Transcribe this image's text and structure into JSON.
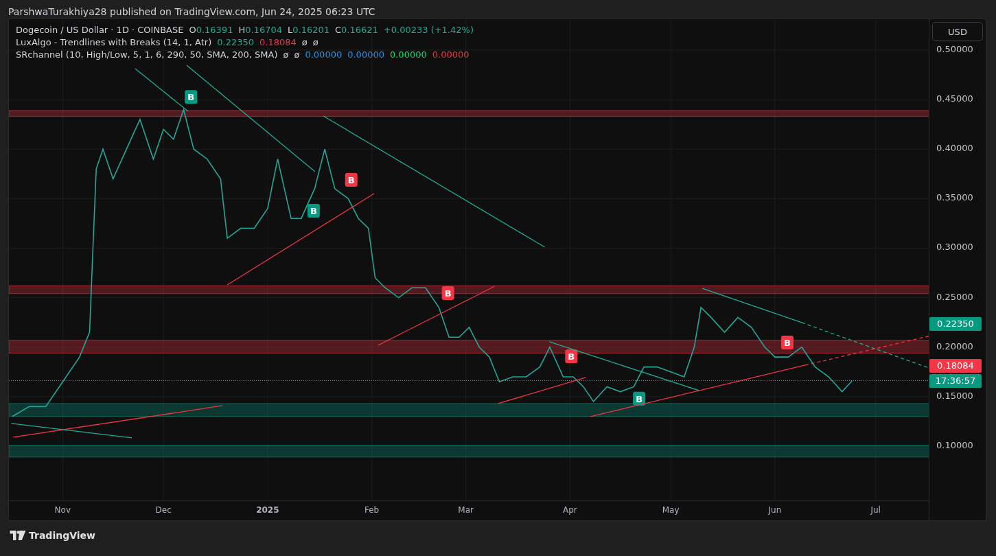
{
  "header": {
    "text": "ParshwaTurakhiya28 published on TradingView.com, Jun 24, 2025 06:23 UTC"
  },
  "legend": [
    {
      "title": "Dogecoin / US Dollar · 1D · COINBASE",
      "values": [
        {
          "label": "O",
          "text": "0.16391",
          "color": "#22ab94"
        },
        {
          "label": "H",
          "text": "0.16704",
          "color": "#22ab94"
        },
        {
          "label": "L",
          "text": "0.16201",
          "color": "#22ab94"
        },
        {
          "label": "C",
          "text": "0.16621",
          "color": "#22ab94"
        },
        {
          "text": "+0.00233 (+1.42%)",
          "color": "#22ab94"
        }
      ]
    },
    {
      "title": "LuxAlgo - Trendlines with Breaks (14, 1, Atr)",
      "values": [
        {
          "text": "0.22350",
          "color": "#22ab94"
        },
        {
          "text": "0.18084",
          "color": "#f23645"
        },
        {
          "text": "ø",
          "color": "#d1d4dc"
        },
        {
          "text": "ø",
          "color": "#d1d4dc"
        }
      ]
    },
    {
      "title": "SRchannel (10, High/Low, 5, 1, 6, 290, 50, SMA, 200, SMA)",
      "values": [
        {
          "text": "ø",
          "color": "#d1d4dc"
        },
        {
          "text": "ø",
          "color": "#d1d4dc"
        },
        {
          "text": "0.00000",
          "color": "#2196f3"
        },
        {
          "text": "0.00000",
          "color": "#2196f3"
        },
        {
          "text": "0.00000",
          "color": "#00e676"
        },
        {
          "text": "0.00000",
          "color": "#f23645"
        }
      ]
    }
  ],
  "currency_button": "USD",
  "price_markers": [
    {
      "kind": "price",
      "text": "0.22350",
      "color": "#089981"
    },
    {
      "kind": "price",
      "text": "0.18084",
      "color": "#f23645"
    },
    {
      "kind": "countdown",
      "text": "17:36:57",
      "color": "#089981"
    }
  ],
  "break_markers": [
    {
      "text": "B",
      "color": "#089981"
    },
    {
      "text": "B",
      "color": "#f23645"
    },
    {
      "text": "B",
      "color": "#089981"
    },
    {
      "text": "B",
      "color": "#f23645"
    },
    {
      "text": "B",
      "color": "#f23645"
    },
    {
      "text": "B",
      "color": "#089981"
    },
    {
      "text": "B",
      "color": "#f23645"
    }
  ],
  "chart_data": {
    "type": "line",
    "grid": true,
    "bands": [
      {
        "axis": "y",
        "from": 0.433,
        "to": 0.439,
        "color": "#f23645"
      },
      {
        "axis": "y",
        "from": 0.254,
        "to": 0.262,
        "color": "#f23645"
      },
      {
        "axis": "y",
        "from": 0.194,
        "to": 0.207,
        "color": "#f23645"
      },
      {
        "axis": "y",
        "from": 0.13,
        "to": 0.143,
        "color": "#089981"
      },
      {
        "axis": "y",
        "from": 0.089,
        "to": 0.101,
        "color": "#089981"
      }
    ],
    "ref_lines": [
      {
        "axis": "y",
        "value": 0.16621,
        "color": "#9598a1"
      }
    ],
    "xlim": [
      "2024-10-16",
      "2025-07-17"
    ],
    "ylim": [
      0.0445,
      0.5312
    ],
    "xticks": [
      {
        "value": "2024-11-01",
        "label": "Nov"
      },
      {
        "value": "2024-12-01",
        "label": "Dec"
      },
      {
        "value": "2025-01-01",
        "label": "2025"
      },
      {
        "value": "2025-02-01",
        "label": "Feb"
      },
      {
        "value": "2025-03-01",
        "label": "Mar"
      },
      {
        "value": "2025-04-01",
        "label": "Apr"
      },
      {
        "value": "2025-05-01",
        "label": "May"
      },
      {
        "value": "2025-06-01",
        "label": "Jun"
      },
      {
        "value": "2025-07-01",
        "label": "Jul"
      }
    ],
    "yticks": [
      {
        "value": 0.1,
        "label": "0.10000"
      },
      {
        "value": 0.15,
        "label": "0.15000"
      },
      {
        "value": 0.2,
        "label": "0.20000"
      },
      {
        "value": 0.25,
        "label": "0.25000"
      },
      {
        "value": 0.3,
        "label": "0.30000"
      },
      {
        "value": 0.35,
        "label": "0.35000"
      },
      {
        "value": 0.4,
        "label": "0.40000"
      },
      {
        "value": 0.45,
        "label": "0.45000"
      },
      {
        "value": 0.5,
        "label": "0.50000"
      }
    ],
    "x": [
      "2024-10-17",
      "2024-10-22",
      "2024-10-27",
      "2024-11-01",
      "2024-11-06",
      "2024-11-09",
      "2024-11-10",
      "2024-11-11",
      "2024-11-13",
      "2024-11-16",
      "2024-11-20",
      "2024-11-24",
      "2024-11-28",
      "2024-12-01",
      "2024-12-04",
      "2024-12-07",
      "2024-12-10",
      "2024-12-14",
      "2024-12-18",
      "2024-12-20",
      "2024-12-24",
      "2024-12-28",
      "2025-01-01",
      "2025-01-04",
      "2025-01-08",
      "2025-01-11",
      "2025-01-15",
      "2025-01-18",
      "2025-01-21",
      "2025-01-25",
      "2025-01-28",
      "2025-01-31",
      "2025-02-02",
      "2025-02-05",
      "2025-02-09",
      "2025-02-13",
      "2025-02-17",
      "2025-02-21",
      "2025-02-24",
      "2025-02-27",
      "2025-03-02",
      "2025-03-05",
      "2025-03-08",
      "2025-03-11",
      "2025-03-15",
      "2025-03-19",
      "2025-03-23",
      "2025-03-26",
      "2025-03-30",
      "2025-04-02",
      "2025-04-05",
      "2025-04-08",
      "2025-04-12",
      "2025-04-16",
      "2025-04-20",
      "2025-04-23",
      "2025-04-27",
      "2025-05-01",
      "2025-05-05",
      "2025-05-08",
      "2025-05-10",
      "2025-05-13",
      "2025-05-17",
      "2025-05-21",
      "2025-05-25",
      "2025-05-29",
      "2025-06-01",
      "2025-06-05",
      "2025-06-09",
      "2025-06-13",
      "2025-06-17",
      "2025-06-21",
      "2025-06-24"
    ],
    "series": [
      {
        "color": "#26a69a",
        "values": [
          0.13,
          0.14,
          0.14,
          0.165,
          0.19,
          0.215,
          0.3,
          0.38,
          0.4,
          0.37,
          0.4,
          0.43,
          0.39,
          0.42,
          0.41,
          0.44,
          0.4,
          0.39,
          0.37,
          0.31,
          0.32,
          0.32,
          0.34,
          0.39,
          0.33,
          0.33,
          0.36,
          0.4,
          0.36,
          0.35,
          0.33,
          0.32,
          0.27,
          0.26,
          0.25,
          0.26,
          0.26,
          0.24,
          0.21,
          0.21,
          0.22,
          0.2,
          0.19,
          0.165,
          0.17,
          0.17,
          0.18,
          0.2,
          0.17,
          0.17,
          0.16,
          0.145,
          0.16,
          0.155,
          0.16,
          0.18,
          0.18,
          0.175,
          0.17,
          0.2,
          0.24,
          0.23,
          0.215,
          0.23,
          0.22,
          0.2,
          0.19,
          0.19,
          0.2,
          0.18,
          0.17,
          0.155,
          0.166
        ]
      }
    ]
  },
  "footer": {
    "brand": "TradingView"
  }
}
